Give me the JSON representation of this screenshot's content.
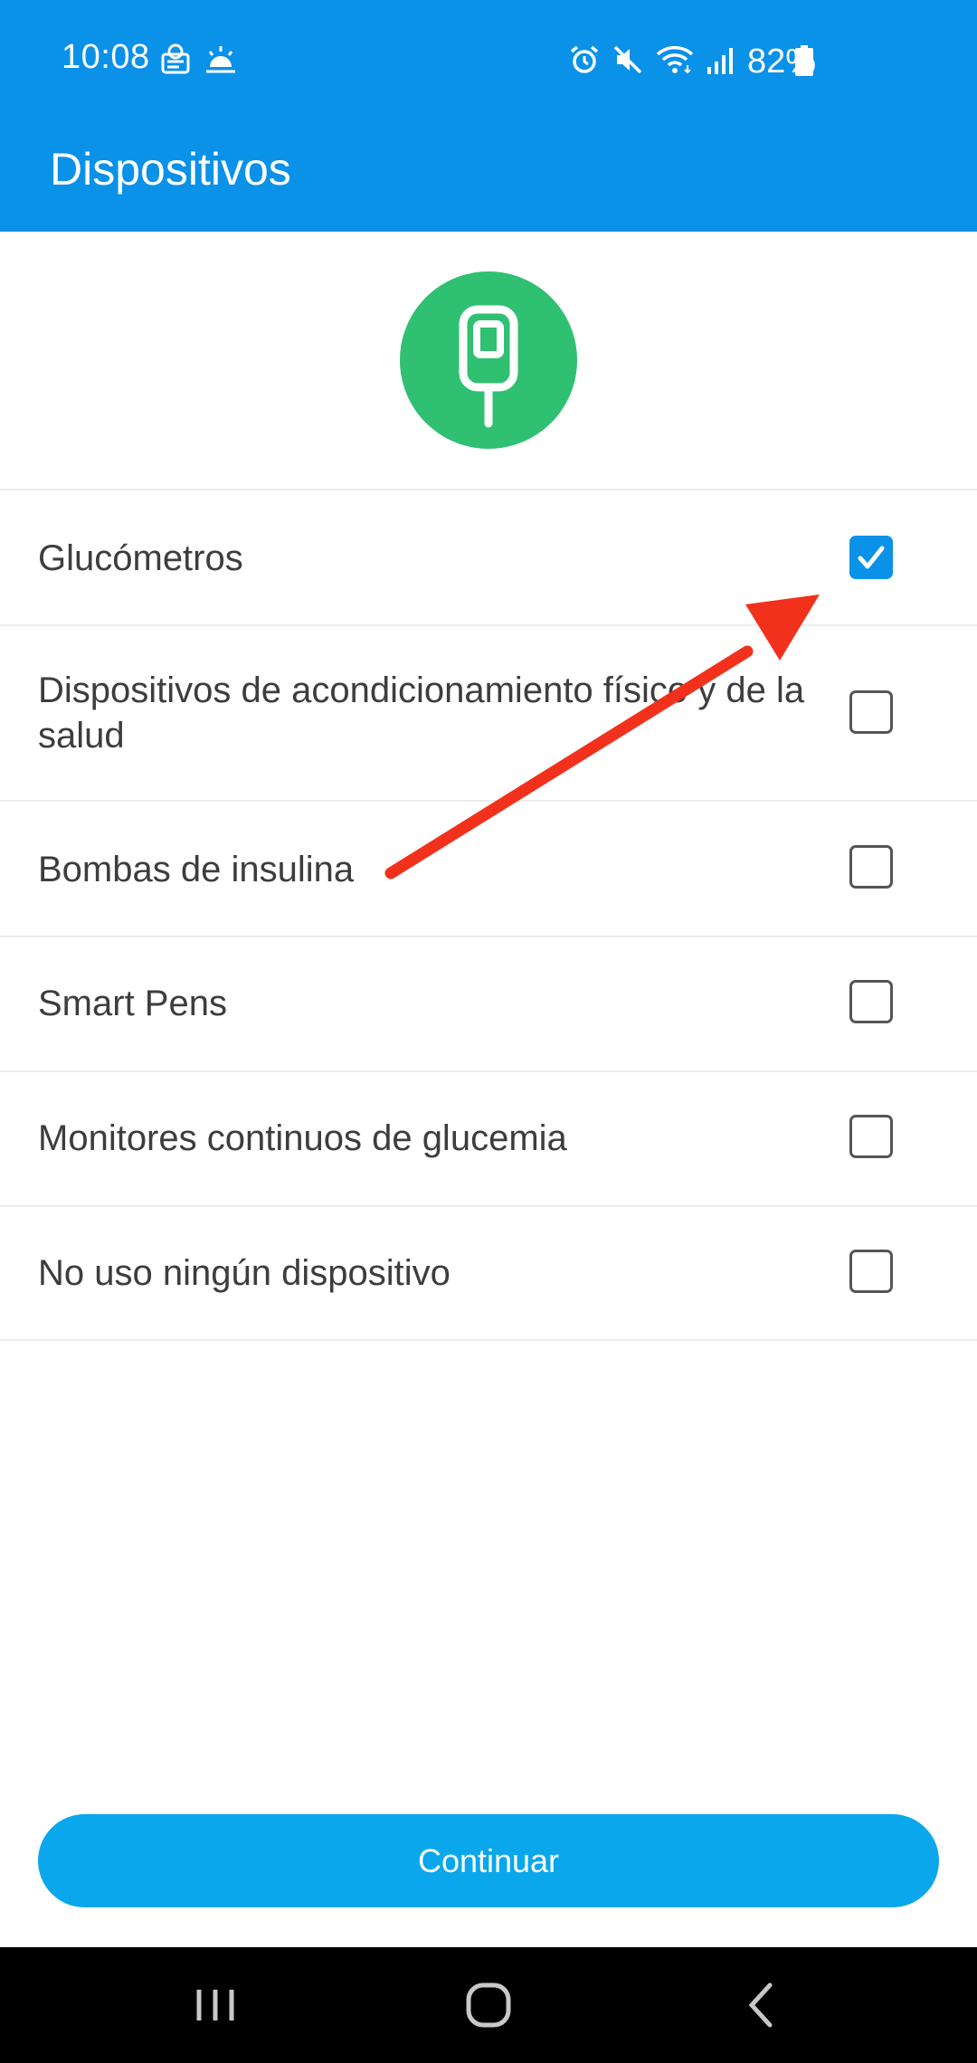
{
  "status_bar": {
    "time": "10:08",
    "battery": "82%",
    "left_icons": [
      "notification-app-icon",
      "weather-icon"
    ],
    "right_icons": [
      "alarm-icon",
      "mute-icon",
      "wifi-icon",
      "signal-icon",
      "battery-icon"
    ]
  },
  "header": {
    "title": "Dispositivos"
  },
  "hero": {
    "icon": "glucometer-icon"
  },
  "device_options": [
    {
      "label": "Glucómetros",
      "checked": true
    },
    {
      "label": "Dispositivos de acondicionamiento físico y de la salud",
      "checked": false
    },
    {
      "label": "Bombas de insulina",
      "checked": false
    },
    {
      "label": "Smart Pens",
      "checked": false
    },
    {
      "label": "Monitores continuos de glucemia",
      "checked": false
    },
    {
      "label": "No uso ningún dispositivo",
      "checked": false
    }
  ],
  "continue_label": "Continuar",
  "nav_bar": {
    "icons": [
      "recent-apps-icon",
      "home-icon",
      "back-icon"
    ]
  },
  "colors": {
    "header": "#0a91e8",
    "accent_button": "#0aa7ec",
    "device_badge": "#2fc072",
    "annotation_arrow": "#f2311d"
  }
}
